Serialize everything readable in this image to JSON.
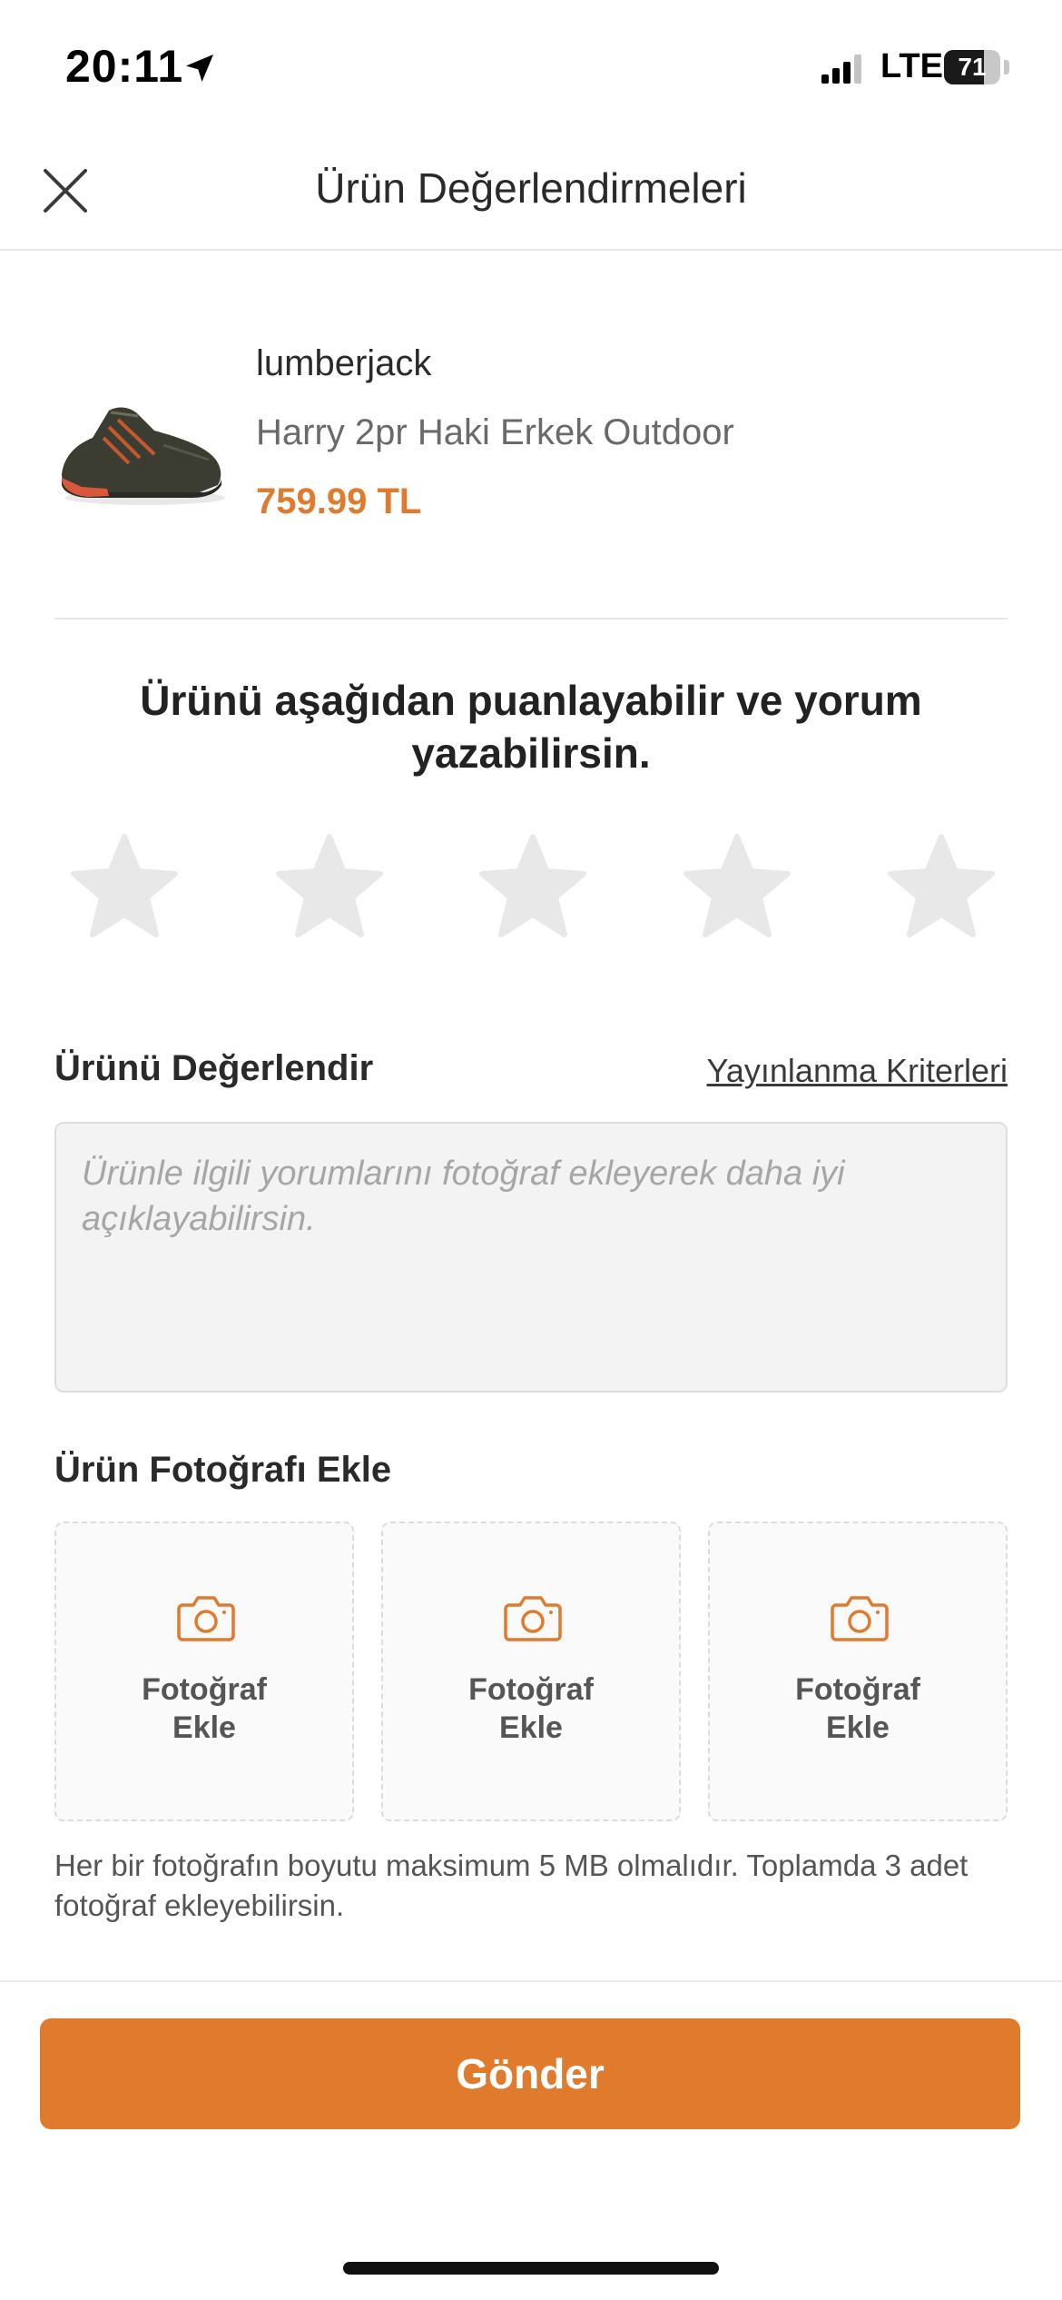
{
  "status_bar": {
    "time": "20:11",
    "network": "LTE",
    "battery": "71",
    "icons": [
      "location-arrow-icon",
      "signal-icon",
      "battery-icon"
    ]
  },
  "header": {
    "title": "Ürün Değerlendirmeleri",
    "close_icon": "close-icon"
  },
  "product": {
    "brand": "lumberjack",
    "name": "Harry 2pr Haki Erkek Outdoor",
    "price": "759.99 TL"
  },
  "rating": {
    "prompt": "Ürünü aşağıdan puanlayabilir ve yorum yazabilirsin.",
    "star_count": 5,
    "selected": 0
  },
  "review": {
    "title": "Ürünü Değerlendir",
    "criteria_link": "Yayınlanma Kriterleri",
    "placeholder": "Ürünle ilgili yorumlarını fotoğraf ekleyerek daha iyi açıklayabilirsin.",
    "value": ""
  },
  "photos": {
    "title": "Ürün Fotoğrafı Ekle",
    "slots": [
      {
        "label": "Fotoğraf\nEkle"
      },
      {
        "label": "Fotoğraf\nEkle"
      },
      {
        "label": "Fotoğraf\nEkle"
      }
    ],
    "info": "Her bir fotoğrafın boyutu maksimum 5 MB olmalıdır. Toplamda 3 adet fotoğraf ekleyebilirsin."
  },
  "submit": {
    "label": "Gönder"
  },
  "colors": {
    "accent": "#e07b2e",
    "star_empty": "#e8e8e8",
    "input_bg": "#f3f3f3"
  }
}
